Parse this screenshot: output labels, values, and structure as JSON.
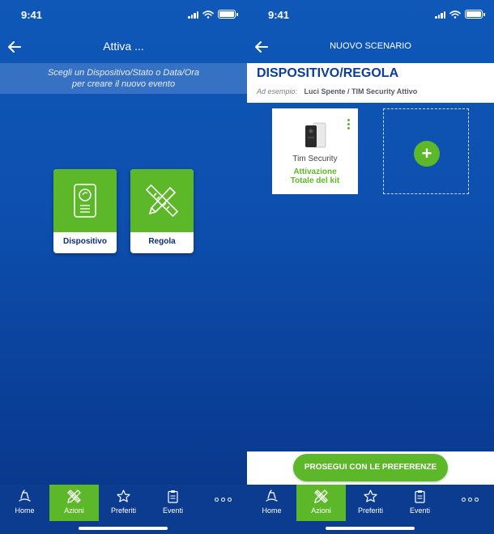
{
  "status_bar": {
    "time": "9:41"
  },
  "left_screen": {
    "header": {
      "title": "Attiva ...",
      "back_icon": "arrow-left-icon"
    },
    "subtitle": [
      "Scegli un Dispositivo/Stato o Data/Ora",
      "per creare il nuovo evento"
    ],
    "cards": [
      {
        "label": "Dispositivo",
        "icon": "device-icon"
      },
      {
        "label": "Regola",
        "icon": "rule-tools-icon"
      }
    ]
  },
  "right_screen": {
    "header": {
      "title": "NUOVO SCENARIO",
      "back_icon": "arrow-left-icon"
    },
    "section": {
      "title": "DISPOSITIVO/REGOLA",
      "example_label": "Ad esempio:",
      "example_value": "Luci Spente / TIM Security Attivo"
    },
    "device_card": {
      "name": "Tim Security",
      "state_line1": "Attivazione",
      "state_line2": "Totale del kit",
      "menu_icon": "kebab-menu-icon"
    },
    "add_button": {
      "label": "+",
      "icon": "plus-icon"
    },
    "continue_button": "PROSEGUI CON LE PREFERENZE"
  },
  "tab_bar": {
    "tabs": [
      {
        "label": "Home",
        "icon": "home-icon"
      },
      {
        "label": "Azioni",
        "icon": "tools-icon",
        "active": true
      },
      {
        "label": "Preferiti",
        "icon": "star-icon"
      },
      {
        "label": "Eventi",
        "icon": "clipboard-icon"
      }
    ],
    "more_icon": "more-dots-icon"
  },
  "colors": {
    "accent_green": "#5cb829",
    "brand_blue": "#0a3e99",
    "background_blue": "#0d4fae"
  }
}
